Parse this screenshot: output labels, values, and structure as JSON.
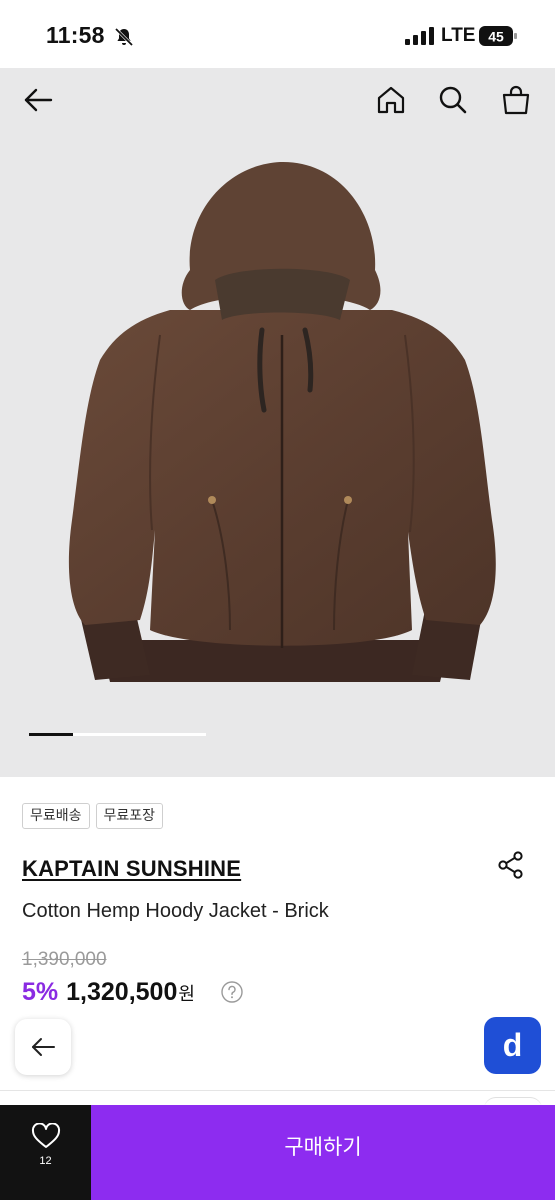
{
  "status_bar": {
    "time": "11:58",
    "network": "LTE",
    "battery": "45"
  },
  "icons": {
    "back": "arrow-left-icon",
    "home": "home-icon",
    "search": "search-icon",
    "cart": "shopping-bag-icon",
    "share": "share-icon",
    "help": "question-circle-icon",
    "like": "heart-icon"
  },
  "product": {
    "tags": [
      "무료배송",
      "무료포장"
    ],
    "brand": "KAPTAIN SUNSHINE",
    "name": "Cotton Hemp Hoody Jacket - Brick",
    "original_price": "1,390,000",
    "discount": "5%",
    "price": "1,320,500",
    "currency": "원"
  },
  "gallery": {
    "current_index": 1,
    "total_images": 4
  },
  "bottom_bar": {
    "like_count": "12",
    "buy_label": "구매하기"
  },
  "floating": {
    "d_button_label": "d"
  },
  "colors": {
    "accent": "#8d2cf0",
    "discount": "#8a2be2",
    "d_button": "#1f4fd6",
    "image_background": "#e8e8e9",
    "like_box": "#121212"
  }
}
